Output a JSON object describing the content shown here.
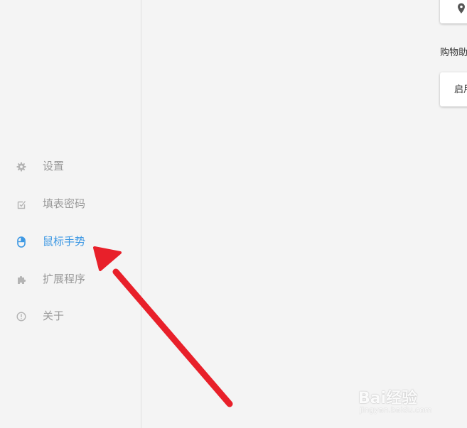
{
  "sidebar": {
    "items": [
      {
        "label": "设置",
        "icon": "gear-icon",
        "active": false
      },
      {
        "label": "填表密码",
        "icon": "form-check-icon",
        "active": false
      },
      {
        "label": "鼠标手势",
        "icon": "mouse-icon",
        "active": true
      },
      {
        "label": "扩展程序",
        "icon": "puzzle-icon",
        "active": false
      },
      {
        "label": "关于",
        "icon": "info-icon",
        "active": false
      }
    ]
  },
  "main": {
    "location_card": {
      "icon": "location-pin-icon"
    },
    "section_label": "购物助",
    "enable_button_label": "启用"
  },
  "annotation": {
    "arrow_color": "#e8202a",
    "arrow_target": "鼠标手势"
  },
  "watermark": {
    "logo": "Bai经验",
    "url": "jingyan.baidu.com"
  },
  "colors": {
    "background": "#f4f4f4",
    "active_item": "#3b97e3",
    "inactive_item": "#9a9a9a"
  }
}
